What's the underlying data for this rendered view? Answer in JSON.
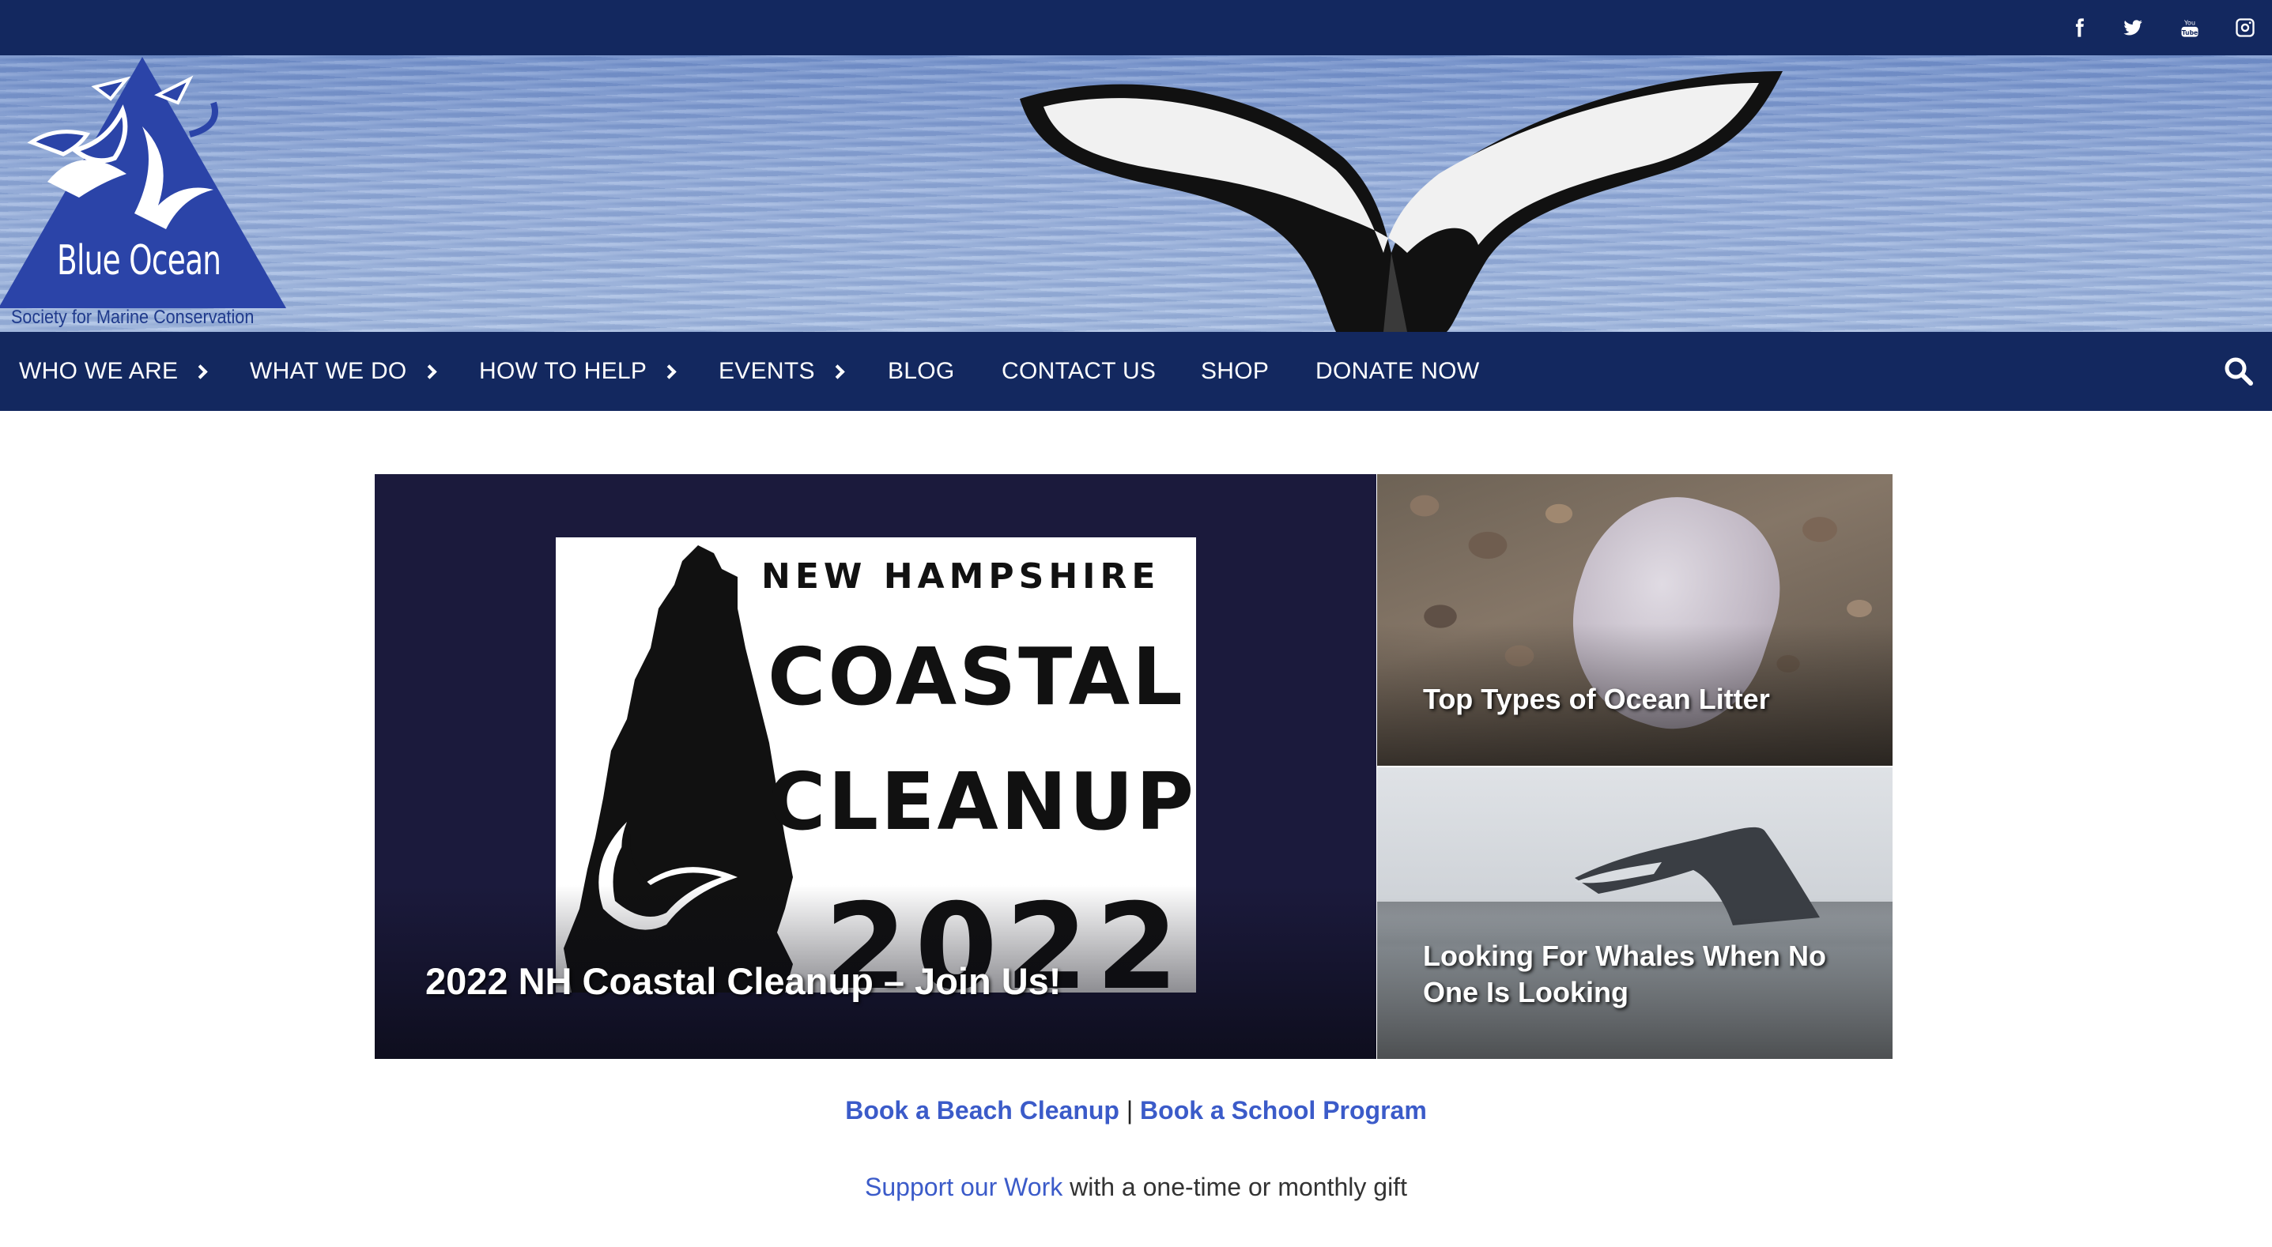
{
  "social": {
    "items": [
      {
        "name": "facebook",
        "icon": "facebook-icon"
      },
      {
        "name": "twitter",
        "icon": "twitter-icon"
      },
      {
        "name": "youtube",
        "icon": "youtube-icon",
        "label": "You Tube"
      },
      {
        "name": "instagram",
        "icon": "instagram-icon"
      }
    ]
  },
  "logo": {
    "title": "Blue Ocean",
    "subtitle": "Society for Marine Conservation",
    "color": "#2b44a8"
  },
  "nav": {
    "items": [
      {
        "label": "WHO WE ARE",
        "has_submenu": true
      },
      {
        "label": "WHAT WE DO",
        "has_submenu": true
      },
      {
        "label": "HOW TO HELP",
        "has_submenu": true
      },
      {
        "label": "EVENTS",
        "has_submenu": true
      },
      {
        "label": "BLOG",
        "has_submenu": false
      },
      {
        "label": "CONTACT US",
        "has_submenu": false
      },
      {
        "label": "SHOP",
        "has_submenu": false
      },
      {
        "label": "DONATE NOW",
        "has_submenu": false
      }
    ],
    "search_icon": "search-icon",
    "background": "#13285f"
  },
  "featured": {
    "main": {
      "title": "2022 NH Coastal Cleanup – Join Us!",
      "image_text": {
        "line1": "NEW HAMPSHIRE",
        "line2": "COASTAL",
        "line3": "CLEANUP",
        "line4": "2022"
      }
    },
    "side": [
      {
        "title": "Top Types of Ocean Litter"
      },
      {
        "title": "Looking For Whales When No One Is Looking"
      }
    ]
  },
  "links": {
    "beach_cleanup": "Book a Beach Cleanup",
    "separator": "|",
    "school_program": "Book a School Program",
    "support_link": "Support our Work",
    "support_text": " with a one-time or monthly gift",
    "link_color": "#3b5bc9"
  }
}
